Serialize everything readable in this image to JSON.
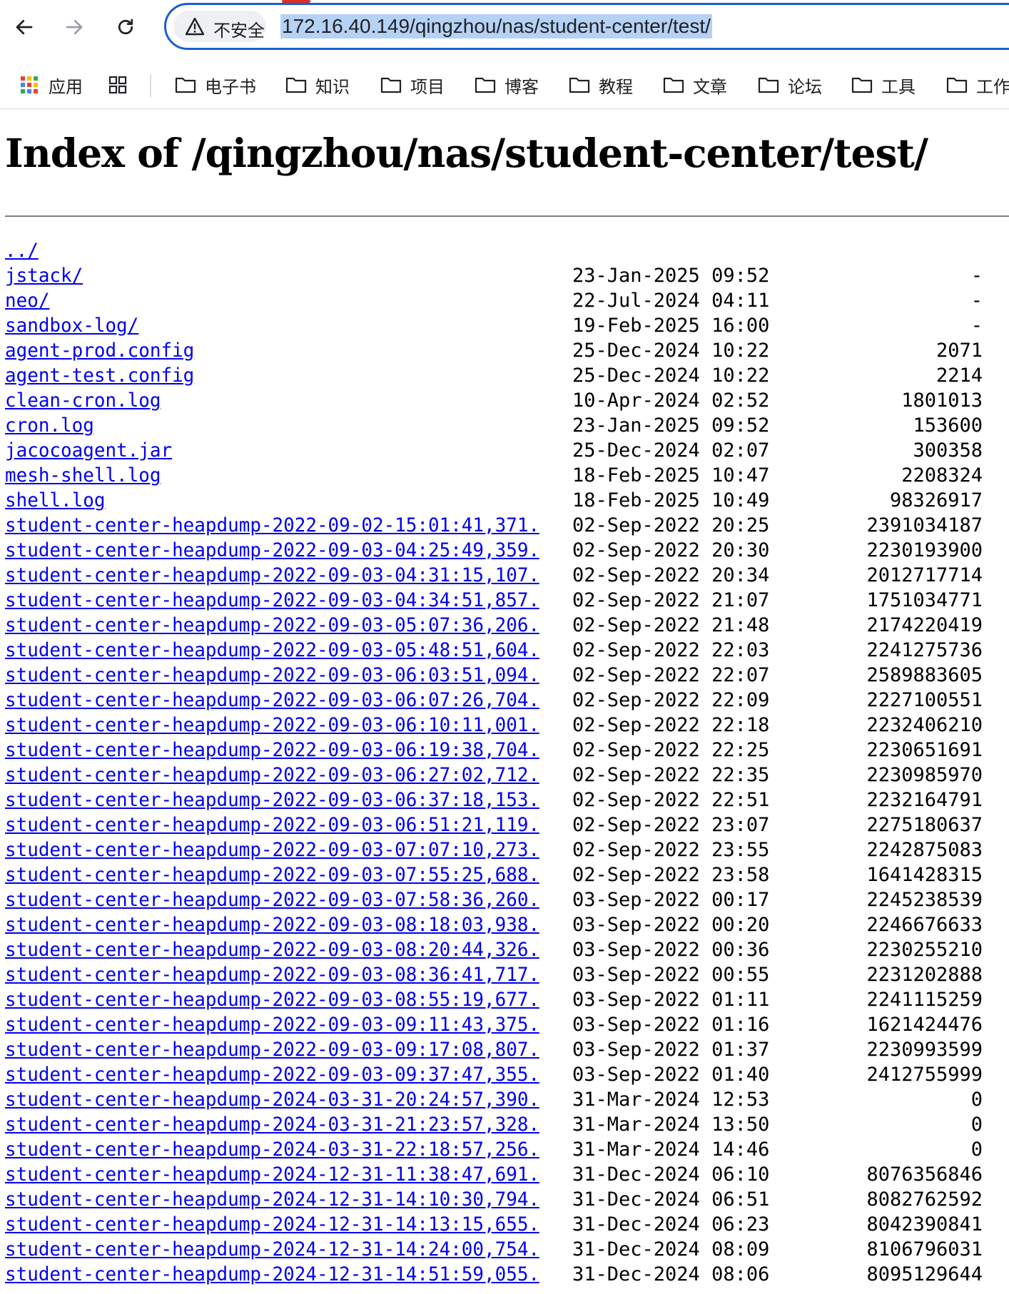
{
  "browser": {
    "security_label": "不安全",
    "url": "172.16.40.149/qingzhou/nas/student-center/test/",
    "bookmarks": [
      {
        "label": "应用",
        "icon": "apps-grid-icon"
      },
      {
        "label": "电子书",
        "icon": "folder-icon"
      },
      {
        "label": "知识",
        "icon": "folder-icon"
      },
      {
        "label": "项目",
        "icon": "folder-icon"
      },
      {
        "label": "博客",
        "icon": "folder-icon"
      },
      {
        "label": "教程",
        "icon": "folder-icon"
      },
      {
        "label": "文章",
        "icon": "folder-icon"
      },
      {
        "label": "论坛",
        "icon": "folder-icon"
      },
      {
        "label": "工具",
        "icon": "folder-icon"
      },
      {
        "label": "工作",
        "icon": "folder-icon"
      }
    ]
  },
  "page": {
    "title": "Index of /qingzhou/nas/student-center/test/",
    "entries": [
      {
        "name": "../",
        "date": "",
        "size": ""
      },
      {
        "name": "jstack/",
        "date": "23-Jan-2025 09:52",
        "size": "-"
      },
      {
        "name": "neo/",
        "date": "22-Jul-2024 04:11",
        "size": "-"
      },
      {
        "name": "sandbox-log/",
        "date": "19-Feb-2025 16:00",
        "size": "-"
      },
      {
        "name": "agent-prod.config",
        "date": "25-Dec-2024 10:22",
        "size": "2071"
      },
      {
        "name": "agent-test.config",
        "date": "25-Dec-2024 10:22",
        "size": "2214"
      },
      {
        "name": "clean-cron.log",
        "date": "10-Apr-2024 02:52",
        "size": "1801013"
      },
      {
        "name": "cron.log",
        "date": "23-Jan-2025 09:52",
        "size": "153600"
      },
      {
        "name": "jacocoagent.jar",
        "date": "25-Dec-2024 02:07",
        "size": "300358"
      },
      {
        "name": "mesh-shell.log",
        "date": "18-Feb-2025 10:47",
        "size": "2208324"
      },
      {
        "name": "shell.log",
        "date": "18-Feb-2025 10:49",
        "size": "98326917"
      },
      {
        "name": "student-center-heapdump-2022-09-02-15:01:41,371..>",
        "date": "02-Sep-2022 20:25",
        "size": "2391034187"
      },
      {
        "name": "student-center-heapdump-2022-09-03-04:25:49,359..>",
        "date": "02-Sep-2022 20:30",
        "size": "2230193900"
      },
      {
        "name": "student-center-heapdump-2022-09-03-04:31:15,107..>",
        "date": "02-Sep-2022 20:34",
        "size": "2012717714"
      },
      {
        "name": "student-center-heapdump-2022-09-03-04:34:51,857..>",
        "date": "02-Sep-2022 21:07",
        "size": "1751034771"
      },
      {
        "name": "student-center-heapdump-2022-09-03-05:07:36,206..>",
        "date": "02-Sep-2022 21:48",
        "size": "2174220419"
      },
      {
        "name": "student-center-heapdump-2022-09-03-05:48:51,604..>",
        "date": "02-Sep-2022 22:03",
        "size": "2241275736"
      },
      {
        "name": "student-center-heapdump-2022-09-03-06:03:51,094..>",
        "date": "02-Sep-2022 22:07",
        "size": "2589883605"
      },
      {
        "name": "student-center-heapdump-2022-09-03-06:07:26,704..>",
        "date": "02-Sep-2022 22:09",
        "size": "2227100551"
      },
      {
        "name": "student-center-heapdump-2022-09-03-06:10:11,001..>",
        "date": "02-Sep-2022 22:18",
        "size": "2232406210"
      },
      {
        "name": "student-center-heapdump-2022-09-03-06:19:38,704..>",
        "date": "02-Sep-2022 22:25",
        "size": "2230651691"
      },
      {
        "name": "student-center-heapdump-2022-09-03-06:27:02,712..>",
        "date": "02-Sep-2022 22:35",
        "size": "2230985970"
      },
      {
        "name": "student-center-heapdump-2022-09-03-06:37:18,153..>",
        "date": "02-Sep-2022 22:51",
        "size": "2232164791"
      },
      {
        "name": "student-center-heapdump-2022-09-03-06:51:21,119..>",
        "date": "02-Sep-2022 23:07",
        "size": "2275180637"
      },
      {
        "name": "student-center-heapdump-2022-09-03-07:07:10,273..>",
        "date": "02-Sep-2022 23:55",
        "size": "2242875083"
      },
      {
        "name": "student-center-heapdump-2022-09-03-07:55:25,688..>",
        "date": "02-Sep-2022 23:58",
        "size": "1641428315"
      },
      {
        "name": "student-center-heapdump-2022-09-03-07:58:36,260..>",
        "date": "03-Sep-2022 00:17",
        "size": "2245238539"
      },
      {
        "name": "student-center-heapdump-2022-09-03-08:18:03,938..>",
        "date": "03-Sep-2022 00:20",
        "size": "2246676633"
      },
      {
        "name": "student-center-heapdump-2022-09-03-08:20:44,326..>",
        "date": "03-Sep-2022 00:36",
        "size": "2230255210"
      },
      {
        "name": "student-center-heapdump-2022-09-03-08:36:41,717..>",
        "date": "03-Sep-2022 00:55",
        "size": "2231202888"
      },
      {
        "name": "student-center-heapdump-2022-09-03-08:55:19,677..>",
        "date": "03-Sep-2022 01:11",
        "size": "2241115259"
      },
      {
        "name": "student-center-heapdump-2022-09-03-09:11:43,375..>",
        "date": "03-Sep-2022 01:16",
        "size": "1621424476"
      },
      {
        "name": "student-center-heapdump-2022-09-03-09:17:08,807..>",
        "date": "03-Sep-2022 01:37",
        "size": "2230993599"
      },
      {
        "name": "student-center-heapdump-2022-09-03-09:37:47,355..>",
        "date": "03-Sep-2022 01:40",
        "size": "2412755999"
      },
      {
        "name": "student-center-heapdump-2024-03-31-20:24:57,390..>",
        "date": "31-Mar-2024 12:53",
        "size": "0"
      },
      {
        "name": "student-center-heapdump-2024-03-31-21:23:57,328..>",
        "date": "31-Mar-2024 13:50",
        "size": "0"
      },
      {
        "name": "student-center-heapdump-2024-03-31-22:18:57,256..>",
        "date": "31-Mar-2024 14:46",
        "size": "0"
      },
      {
        "name": "student-center-heapdump-2024-12-31-11:38:47,691..>",
        "date": "31-Dec-2024 06:10",
        "size": "8076356846"
      },
      {
        "name": "student-center-heapdump-2024-12-31-14:10:30,794..>",
        "date": "31-Dec-2024 06:51",
        "size": "8082762592"
      },
      {
        "name": "student-center-heapdump-2024-12-31-14:13:15,655..>",
        "date": "31-Dec-2024 06:23",
        "size": "8042390841"
      },
      {
        "name": "student-center-heapdump-2024-12-31-14:24:00,754..>",
        "date": "31-Dec-2024 08:09",
        "size": "8106796031"
      },
      {
        "name": "student-center-heapdump-2024-12-31-14:51:59,055..>",
        "date": "31-Dec-2024 08:06",
        "size": "8095129644"
      }
    ]
  },
  "colors": {
    "link": "#0000ee",
    "omnibox_border": "#1a5fd0",
    "url_selection": "#b5d2f5"
  }
}
